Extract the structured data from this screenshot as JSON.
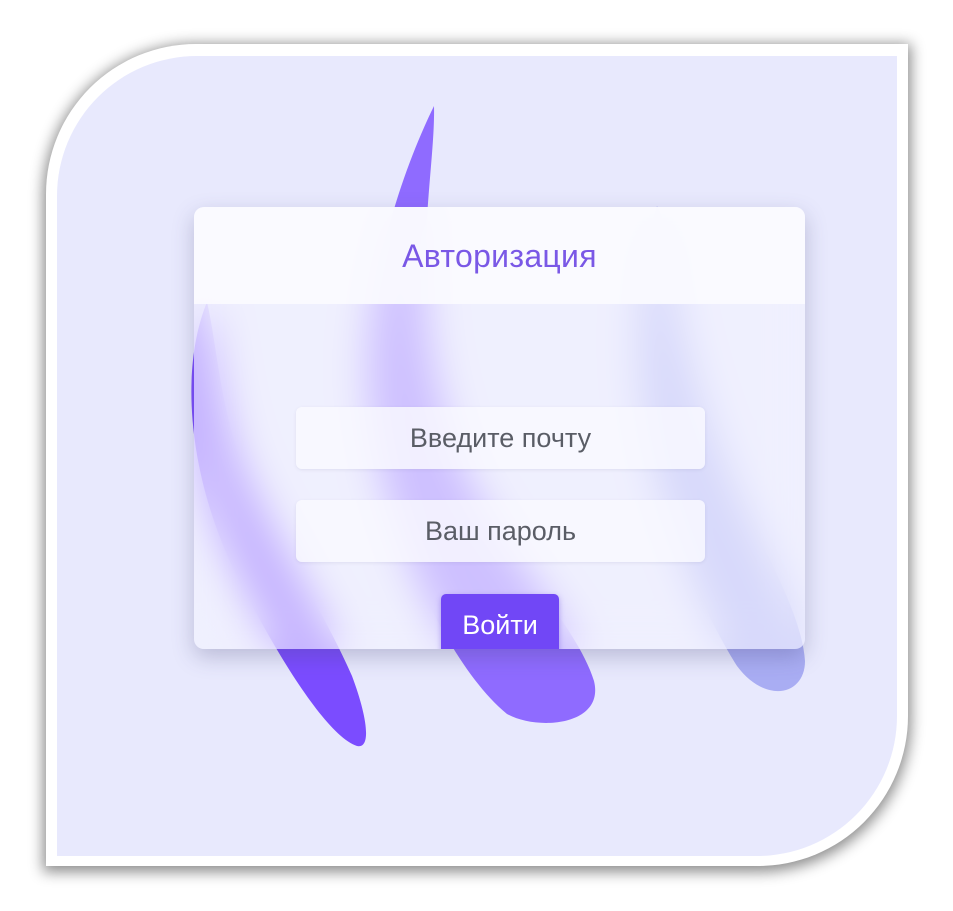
{
  "auth_form": {
    "title": "Авторизация",
    "email_placeholder": "Введите почту",
    "password_placeholder": "Ваш пароль",
    "submit_label": "Войти"
  },
  "colors": {
    "background": "#e8e9fd",
    "accent": "#7147f6",
    "title_text": "#7a58e6",
    "blob_left": "#7b4cff",
    "blob_middle": "#8f6bff",
    "blob_right": "#a9adf3"
  }
}
